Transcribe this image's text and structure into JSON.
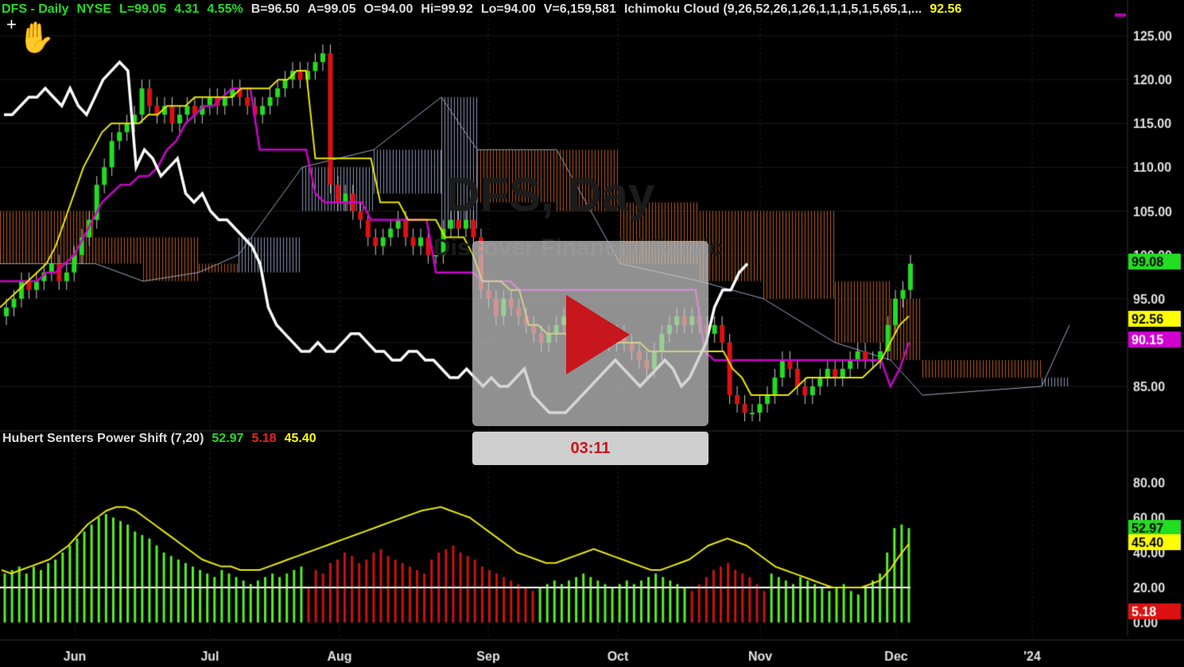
{
  "header": {
    "symbol": "DFS - Daily",
    "exchange": "NYSE",
    "last": "L=99.05",
    "change": "4.31",
    "change_pct": "4.55%",
    "bid": "B=96.50",
    "ask": "A=99.05",
    "open": "O=94.00",
    "high": "Hi=99.92",
    "low": "Lo=94.00",
    "volume": "V=6,159,581",
    "indicator": "Ichimoku Cloud (9,26,52,26,1,26,1,1,1,5,1,5,65,1,...",
    "indicator_value": "92.56"
  },
  "lower_header": {
    "name": "Hubert Senters Power Shift (7,20)",
    "v1": "52.97",
    "v2": "5.18",
    "v3": "45.40"
  },
  "watermark": {
    "line1": "DFS, Day",
    "line2": "Discover Financial Servic"
  },
  "video": {
    "time": "03:11"
  },
  "price_axis": [
    "125.00",
    "120.00",
    "115.00",
    "110.00",
    "105.00",
    "100.00",
    "95.00",
    "85.00"
  ],
  "price_badges": [
    {
      "text": "99.08",
      "color": "#22dd22",
      "textcolor": "#000"
    },
    {
      "text": "92.56",
      "color": "#ffff00",
      "textcolor": "#000"
    },
    {
      "text": "90.15",
      "color": "#d000d0",
      "textcolor": "#fff"
    }
  ],
  "osc_axis": [
    "80.00",
    "60.00",
    "40.00",
    "20.00",
    "0.00"
  ],
  "osc_badges": [
    {
      "text": "52.97",
      "color": "#22dd22",
      "textcolor": "#000"
    },
    {
      "text": "45.40",
      "color": "#ffff00",
      "textcolor": "#000"
    },
    {
      "text": "5.18",
      "color": "#dd1111",
      "textcolor": "#fff"
    }
  ],
  "x_axis": [
    "Jun",
    "Jul",
    "Aug",
    "Sep",
    "Oct",
    "Nov",
    "Dec",
    "'24"
  ],
  "chart_data": [
    {
      "type": "candlestick",
      "title": "DFS - Daily",
      "ylim": [
        81,
        126
      ],
      "close_series": [
        94,
        95,
        97,
        96,
        97,
        98,
        99,
        97,
        98,
        100,
        102,
        104,
        108,
        110,
        113,
        114,
        115,
        116,
        119,
        117,
        116,
        117,
        115,
        116,
        117,
        116,
        117,
        118,
        117,
        118,
        119,
        118,
        117,
        116,
        117,
        118,
        119,
        120,
        121,
        120,
        121,
        122,
        123,
        108,
        106,
        107,
        105,
        104,
        102,
        101,
        102,
        103,
        104,
        102,
        101,
        102,
        100,
        100,
        103,
        104,
        103,
        104,
        102,
        96,
        95,
        93,
        95,
        94,
        93,
        92,
        91,
        90,
        91,
        92,
        93,
        92,
        91,
        90,
        92,
        91,
        90,
        91,
        90,
        89,
        88,
        87,
        89,
        91,
        92,
        93,
        92,
        93,
        92,
        91,
        92,
        90,
        84,
        83,
        82,
        82,
        83,
        84,
        86,
        88,
        87,
        85,
        84,
        85,
        86,
        87,
        86,
        87,
        88,
        89,
        88,
        88,
        89,
        92,
        95,
        96,
        99
      ],
      "chikou": [
        116,
        116,
        117,
        118,
        118,
        119,
        118,
        117,
        119,
        117,
        116,
        118,
        120,
        121,
        122,
        121,
        110,
        112,
        111,
        109,
        110,
        111,
        107,
        106,
        107,
        105,
        104,
        104,
        103,
        102,
        101,
        99,
        94,
        92,
        91,
        90,
        89,
        89,
        90,
        89,
        89,
        90,
        91,
        91,
        90,
        89,
        89,
        88,
        88,
        89,
        89,
        88,
        88,
        87,
        86,
        86,
        87,
        86,
        85,
        86,
        85,
        85,
        86,
        87,
        84,
        83,
        82,
        82,
        82,
        83,
        84,
        85,
        86,
        87,
        88,
        87,
        86,
        85,
        86,
        87,
        88,
        87,
        85,
        86,
        88,
        90,
        94,
        96,
        96,
        98,
        99
      ],
      "tenkan": [
        94,
        95,
        96,
        97,
        98,
        99,
        101,
        104,
        107,
        110,
        112,
        114,
        115,
        115,
        115,
        115,
        116,
        116,
        117,
        117,
        117,
        118,
        118,
        118,
        118,
        118,
        119,
        119,
        119,
        119,
        120,
        120,
        121,
        121,
        111,
        111,
        111,
        111,
        111,
        111,
        111,
        106,
        106,
        106,
        104,
        104,
        104,
        104,
        102,
        102,
        102,
        100,
        97,
        97,
        97,
        96,
        96,
        92,
        92,
        91,
        91,
        91,
        91,
        91,
        91,
        91,
        90,
        90,
        90,
        90,
        89,
        89,
        89,
        89,
        89,
        89,
        89,
        89,
        89,
        87,
        86,
        84,
        84,
        84,
        84,
        84,
        85,
        86,
        86,
        86,
        86,
        86,
        86,
        86,
        87,
        88,
        90,
        92,
        93
      ],
      "kijun": [
        97,
        97,
        97,
        97,
        97,
        98,
        98,
        99,
        100,
        102,
        104,
        106,
        107,
        108,
        108,
        109,
        109,
        110,
        112,
        113,
        115,
        116,
        117,
        117,
        118,
        119,
        119,
        119,
        112,
        112,
        112,
        112,
        112,
        112,
        107,
        106,
        106,
        106,
        106,
        106,
        104,
        104,
        104,
        104,
        104,
        104,
        104,
        98,
        98,
        98,
        98,
        98,
        97,
        97,
        97,
        97,
        96,
        96,
        96,
        96,
        96,
        96,
        96,
        96,
        96,
        96,
        96,
        96,
        96,
        96,
        96,
        96,
        96,
        96,
        96,
        96,
        89,
        88,
        88,
        88,
        88,
        88,
        88,
        88,
        88,
        88,
        88,
        88,
        88,
        88,
        88,
        88,
        88,
        88,
        88,
        88,
        85,
        87,
        90
      ]
    },
    {
      "type": "bar",
      "title": "Hubert Senters Power Shift (7,20)",
      "ylim": [
        0,
        85
      ],
      "bars": [
        28,
        30,
        32,
        28,
        32,
        30,
        34,
        36,
        40,
        44,
        48,
        52,
        56,
        60,
        62,
        60,
        58,
        56,
        52,
        50,
        48,
        44,
        40,
        38,
        36,
        34,
        32,
        30,
        28,
        26,
        30,
        28,
        26,
        24,
        22,
        24,
        26,
        28,
        26,
        28,
        30,
        32,
        -20,
        -30,
        -28,
        -34,
        -36,
        -40,
        -38,
        -34,
        -36,
        -40,
        -42,
        -38,
        -36,
        -34,
        -32,
        -30,
        -28,
        -36,
        -40,
        -42,
        -44,
        -40,
        -38,
        -36,
        -32,
        -30,
        -28,
        -26,
        -24,
        -22,
        -20,
        -18,
        20,
        22,
        24,
        22,
        24,
        26,
        28,
        26,
        24,
        22,
        20,
        22,
        24,
        22,
        24,
        26,
        28,
        26,
        24,
        22,
        20,
        -18,
        -22,
        -26,
        -30,
        -32,
        -34,
        -30,
        -28,
        -26,
        -22,
        -18,
        28,
        26,
        24,
        22,
        26,
        24,
        22,
        20,
        18,
        20,
        22,
        18,
        16,
        20,
        24,
        28,
        40,
        54,
        56,
        54
      ],
      "signal": [
        30,
        28,
        30,
        32,
        34,
        36,
        40,
        44,
        50,
        56,
        60,
        64,
        66,
        66,
        64,
        60,
        56,
        52,
        48,
        44,
        40,
        36,
        34,
        32,
        32,
        30,
        30,
        30,
        32,
        34,
        36,
        38,
        40,
        42,
        44,
        46,
        48,
        50,
        52,
        54,
        56,
        58,
        60,
        62,
        64,
        65,
        66,
        64,
        62,
        60,
        56,
        52,
        48,
        44,
        40,
        38,
        36,
        34,
        34,
        36,
        38,
        40,
        42,
        40,
        38,
        36,
        34,
        32,
        30,
        30,
        32,
        34,
        36,
        40,
        44,
        46,
        48,
        46,
        44,
        40,
        36,
        32,
        30,
        28,
        26,
        24,
        22,
        20,
        20,
        20,
        20,
        22,
        24,
        30,
        38,
        45
      ]
    }
  ]
}
